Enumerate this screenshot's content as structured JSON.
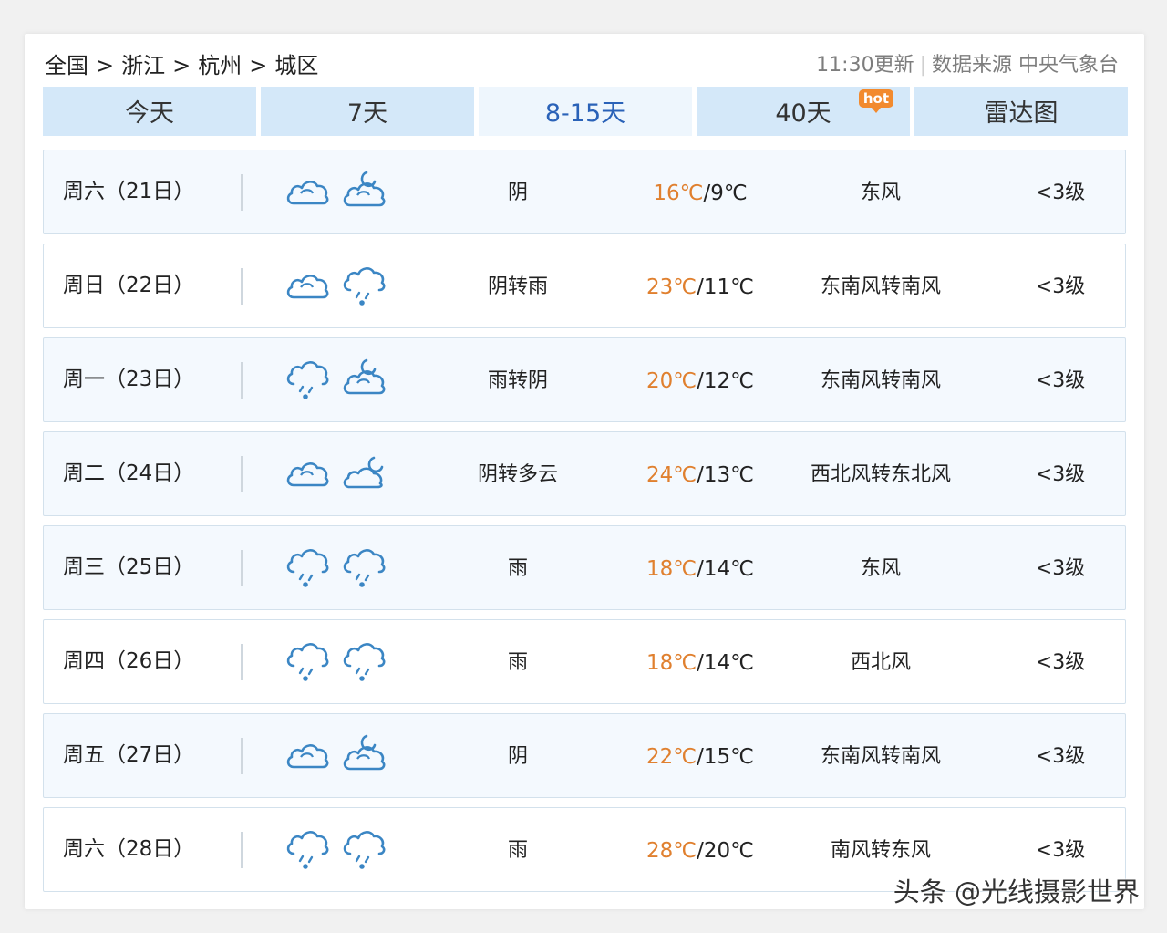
{
  "breadcrumb": {
    "items": [
      "全国",
      "浙江",
      "杭州",
      "城区"
    ],
    "separator": ">"
  },
  "meta": {
    "update_time": "11:30更新",
    "divider": "|",
    "source": "数据来源 中央气象台"
  },
  "tabs": [
    {
      "label": "今天",
      "active": false
    },
    {
      "label": "7天",
      "active": false
    },
    {
      "label": "8-15天",
      "active": true
    },
    {
      "label": "40天",
      "active": false,
      "badge": "hot"
    },
    {
      "label": "雷达图",
      "active": false
    }
  ],
  "colors": {
    "accent_tab_text": "#2a62b8",
    "tab_bg": "#d4e8f9",
    "high_temp": "#e0802f",
    "icon_stroke": "#3b86c4",
    "hot_badge": "#f28a2e"
  },
  "forecast": [
    {
      "day": "周六（21日）",
      "icon_day": "cloud-icon",
      "icon_night": "moon-cloud-icon",
      "condition": "阴",
      "high": "16℃",
      "low": "9℃",
      "wind": "东风",
      "level": "<3级"
    },
    {
      "day": "周日（22日）",
      "icon_day": "cloud-icon",
      "icon_night": "rain-cloud-icon",
      "condition": "阴转雨",
      "high": "23℃",
      "low": "11℃",
      "wind": "东南风转南风",
      "level": "<3级"
    },
    {
      "day": "周一（23日）",
      "icon_day": "rain-cloud-icon",
      "icon_night": "moon-cloud-icon",
      "condition": "雨转阴",
      "high": "20℃",
      "low": "12℃",
      "wind": "东南风转南风",
      "level": "<3级"
    },
    {
      "day": "周二（24日）",
      "icon_day": "cloud-icon",
      "icon_night": "moon-partly-cloudy-icon",
      "condition": "阴转多云",
      "high": "24℃",
      "low": "13℃",
      "wind": "西北风转东北风",
      "level": "<3级"
    },
    {
      "day": "周三（25日）",
      "icon_day": "rain-cloud-icon",
      "icon_night": "rain-cloud-icon",
      "condition": "雨",
      "high": "18℃",
      "low": "14℃",
      "wind": "东风",
      "level": "<3级"
    },
    {
      "day": "周四（26日）",
      "icon_day": "rain-cloud-icon",
      "icon_night": "rain-cloud-icon",
      "condition": "雨",
      "high": "18℃",
      "low": "14℃",
      "wind": "西北风",
      "level": "<3级"
    },
    {
      "day": "周五（27日）",
      "icon_day": "cloud-icon",
      "icon_night": "moon-cloud-icon",
      "condition": "阴",
      "high": "22℃",
      "low": "15℃",
      "wind": "东南风转南风",
      "level": "<3级"
    },
    {
      "day": "周六（28日）",
      "icon_day": "rain-cloud-icon",
      "icon_night": "rain-cloud-icon",
      "condition": "雨",
      "high": "28℃",
      "low": "20℃",
      "wind": "南风转东风",
      "level": "<3级"
    }
  ],
  "watermark": "头条 @光线摄影世界"
}
